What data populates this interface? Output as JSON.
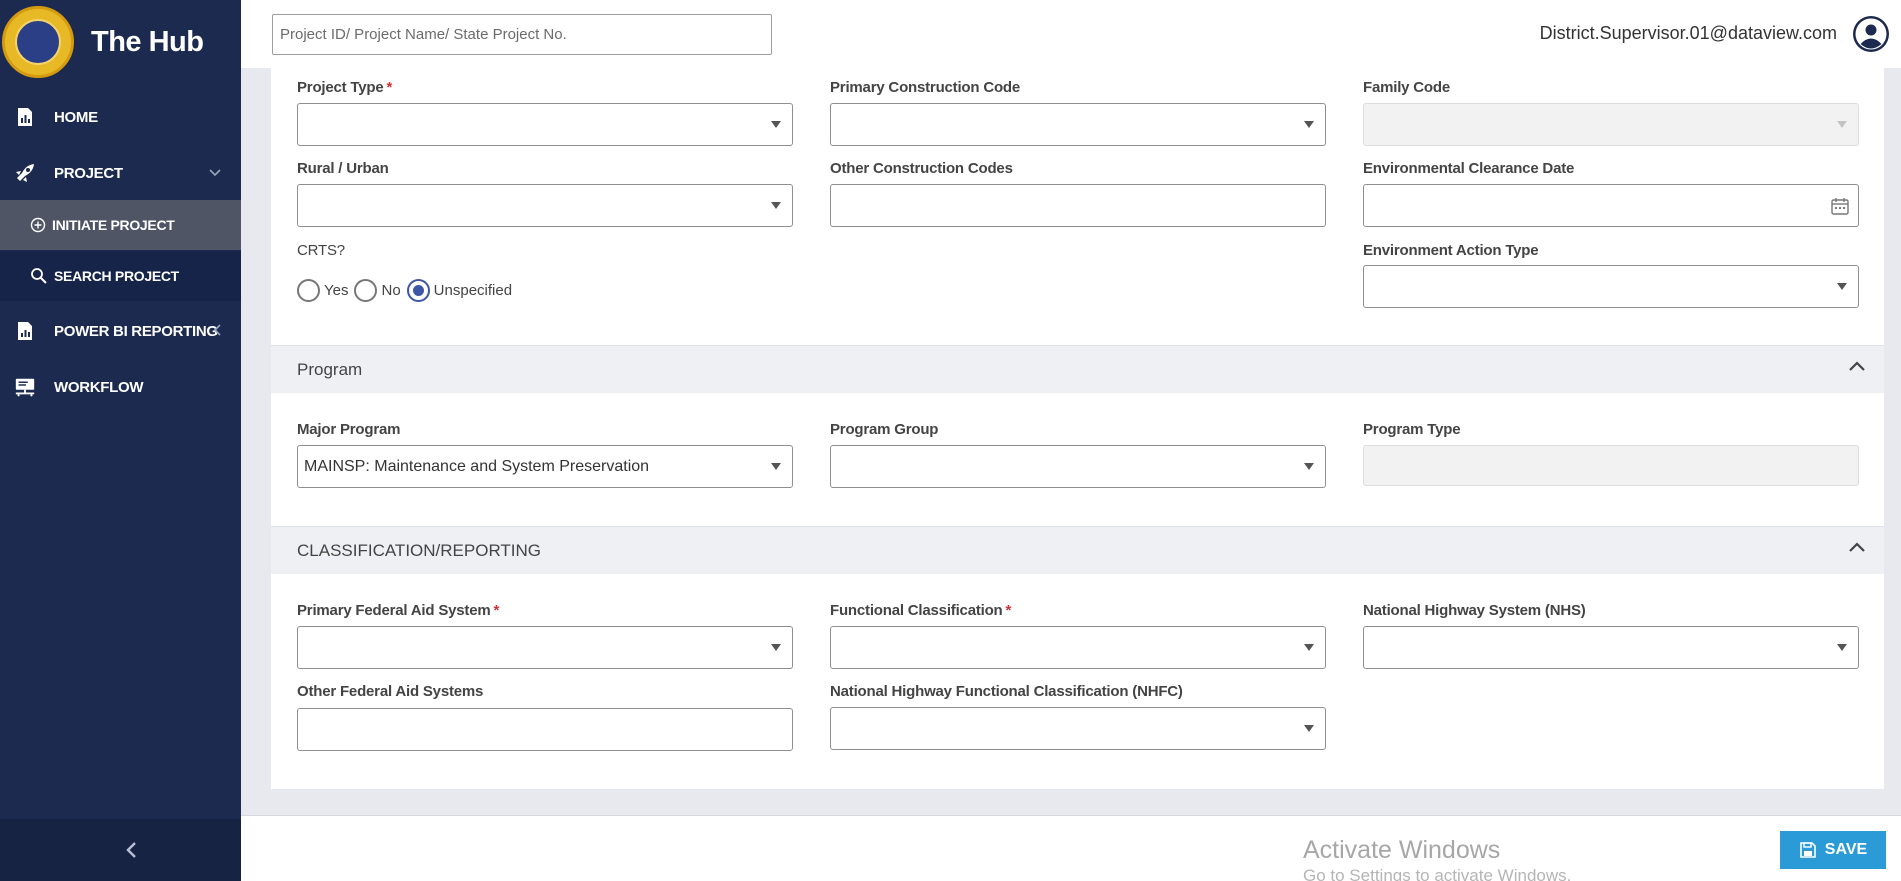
{
  "app": {
    "title": "The Hub"
  },
  "sidebar": {
    "items": [
      {
        "label": "HOME",
        "icon": "bar-chart-icon"
      },
      {
        "label": "PROJECT",
        "icon": "rocket-icon"
      },
      {
        "label": "POWER BI REPORTING",
        "icon": "report-icon"
      },
      {
        "label": "WORKFLOW",
        "icon": "workflow-icon"
      }
    ],
    "subitems": [
      {
        "label": "INITIATE PROJECT",
        "icon": "plus-circle-icon"
      },
      {
        "label": "SEARCH PROJECT",
        "icon": "search-icon"
      }
    ]
  },
  "header": {
    "search_placeholder": "Project ID/ Project Name/ State Project No.",
    "user_email": "District.Supervisor.01@dataview.com"
  },
  "form": {
    "project_type_label": "Project Type",
    "primary_construction_code_label": "Primary Construction Code",
    "family_code_label": "Family Code",
    "rural_urban_label": "Rural / Urban",
    "other_construction_codes_label": "Other Construction Codes",
    "environmental_clearance_date_label": "Environmental Clearance Date",
    "crts_label": "CRTS?",
    "crts_options": [
      "Yes",
      "No",
      "Unspecified"
    ],
    "crts_selected": "Unspecified",
    "environment_action_type_label": "Environment Action Type"
  },
  "program": {
    "title": "Program",
    "major_program_label": "Major Program",
    "major_program_value": "MAINSP: Maintenance and System Preservation",
    "program_group_label": "Program Group",
    "program_type_label": "Program Type"
  },
  "classification": {
    "title": "CLASSIFICATION/REPORTING",
    "primary_federal_aid_label": "Primary Federal Aid System",
    "functional_classification_label": "Functional Classification",
    "nhs_label": "National Highway System (NHS)",
    "other_federal_aid_label": "Other Federal Aid Systems",
    "nhfc_label": "National Highway Functional Classification (NHFC)"
  },
  "footer": {
    "save_label": "SAVE",
    "watermark_title": "Activate Windows",
    "watermark_sub": "Go to Settings to activate Windows."
  }
}
